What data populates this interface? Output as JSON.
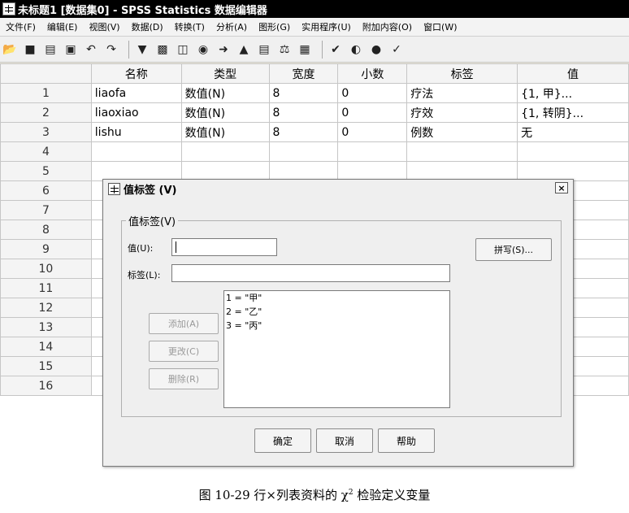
{
  "window": {
    "title": "未标题1 [数据集0] - SPSS Statistics 数据编辑器"
  },
  "menu": [
    "文件(F)",
    "编辑(E)",
    "视图(V)",
    "数据(D)",
    "转换(T)",
    "分析(A)",
    "图形(G)",
    "实用程序(U)",
    "附加内容(O)",
    "窗口(W)"
  ],
  "grid": {
    "headers": [
      "名称",
      "类型",
      "宽度",
      "小数",
      "标签",
      "值"
    ],
    "rows": [
      [
        "1",
        "liaofa",
        "数值(N)",
        "8",
        "0",
        "疗法",
        "{1, 甲}..."
      ],
      [
        "2",
        "liaoxiao",
        "数值(N)",
        "8",
        "0",
        "疗效",
        "{1, 转阴}..."
      ],
      [
        "3",
        "lishu",
        "数值(N)",
        "8",
        "0",
        "例数",
        "无"
      ],
      [
        "4"
      ],
      [
        "5"
      ],
      [
        "6"
      ],
      [
        "7"
      ],
      [
        "8"
      ],
      [
        "9"
      ],
      [
        "10"
      ],
      [
        "11"
      ],
      [
        "12"
      ],
      [
        "13"
      ],
      [
        "14"
      ],
      [
        "15"
      ],
      [
        "16"
      ]
    ]
  },
  "dialog": {
    "title": "值标签 (V)",
    "close": "×",
    "group_label": "值标签(V)",
    "value_label": "值(U):",
    "value_text": "",
    "label_label": "标签(L):",
    "label_text": "",
    "spell_button": "拼写(S)...",
    "add_button": "添加(A)",
    "change_button": "更改(C)",
    "delete_button": "删除(R)",
    "list_items": [
      "1 = \"甲\"",
      "2 = \"乙\"",
      "3 = \"丙\""
    ],
    "ok_button": "确定",
    "cancel_button": "取消",
    "help_button": "帮助"
  },
  "caption": {
    "prefix": "图 10-29   行×列表资料的 χ",
    "sup": "2",
    "suffix": " 检验定义变量"
  }
}
